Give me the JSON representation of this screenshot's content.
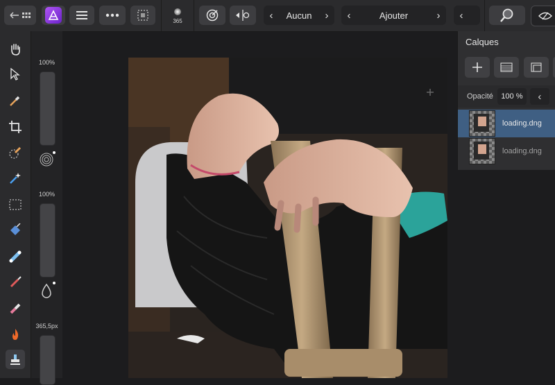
{
  "topbar": {
    "brush_size": "365",
    "selection_mode": "Aucun",
    "blend_mode": "Ajouter"
  },
  "left_sliders": {
    "opacity_label": "100%",
    "flow_label": "100%",
    "width_label": "365,5px"
  },
  "layers_panel": {
    "title": "Calques",
    "opacity_label": "Opacité",
    "opacity_value": "100 %",
    "layers": [
      {
        "name": "loading.dng",
        "selected": true
      },
      {
        "name": "loading.dng",
        "selected": false
      }
    ]
  },
  "colors": {
    "accent_selected_row": "#3f5f83",
    "app_icon": "#8b3fe0"
  }
}
